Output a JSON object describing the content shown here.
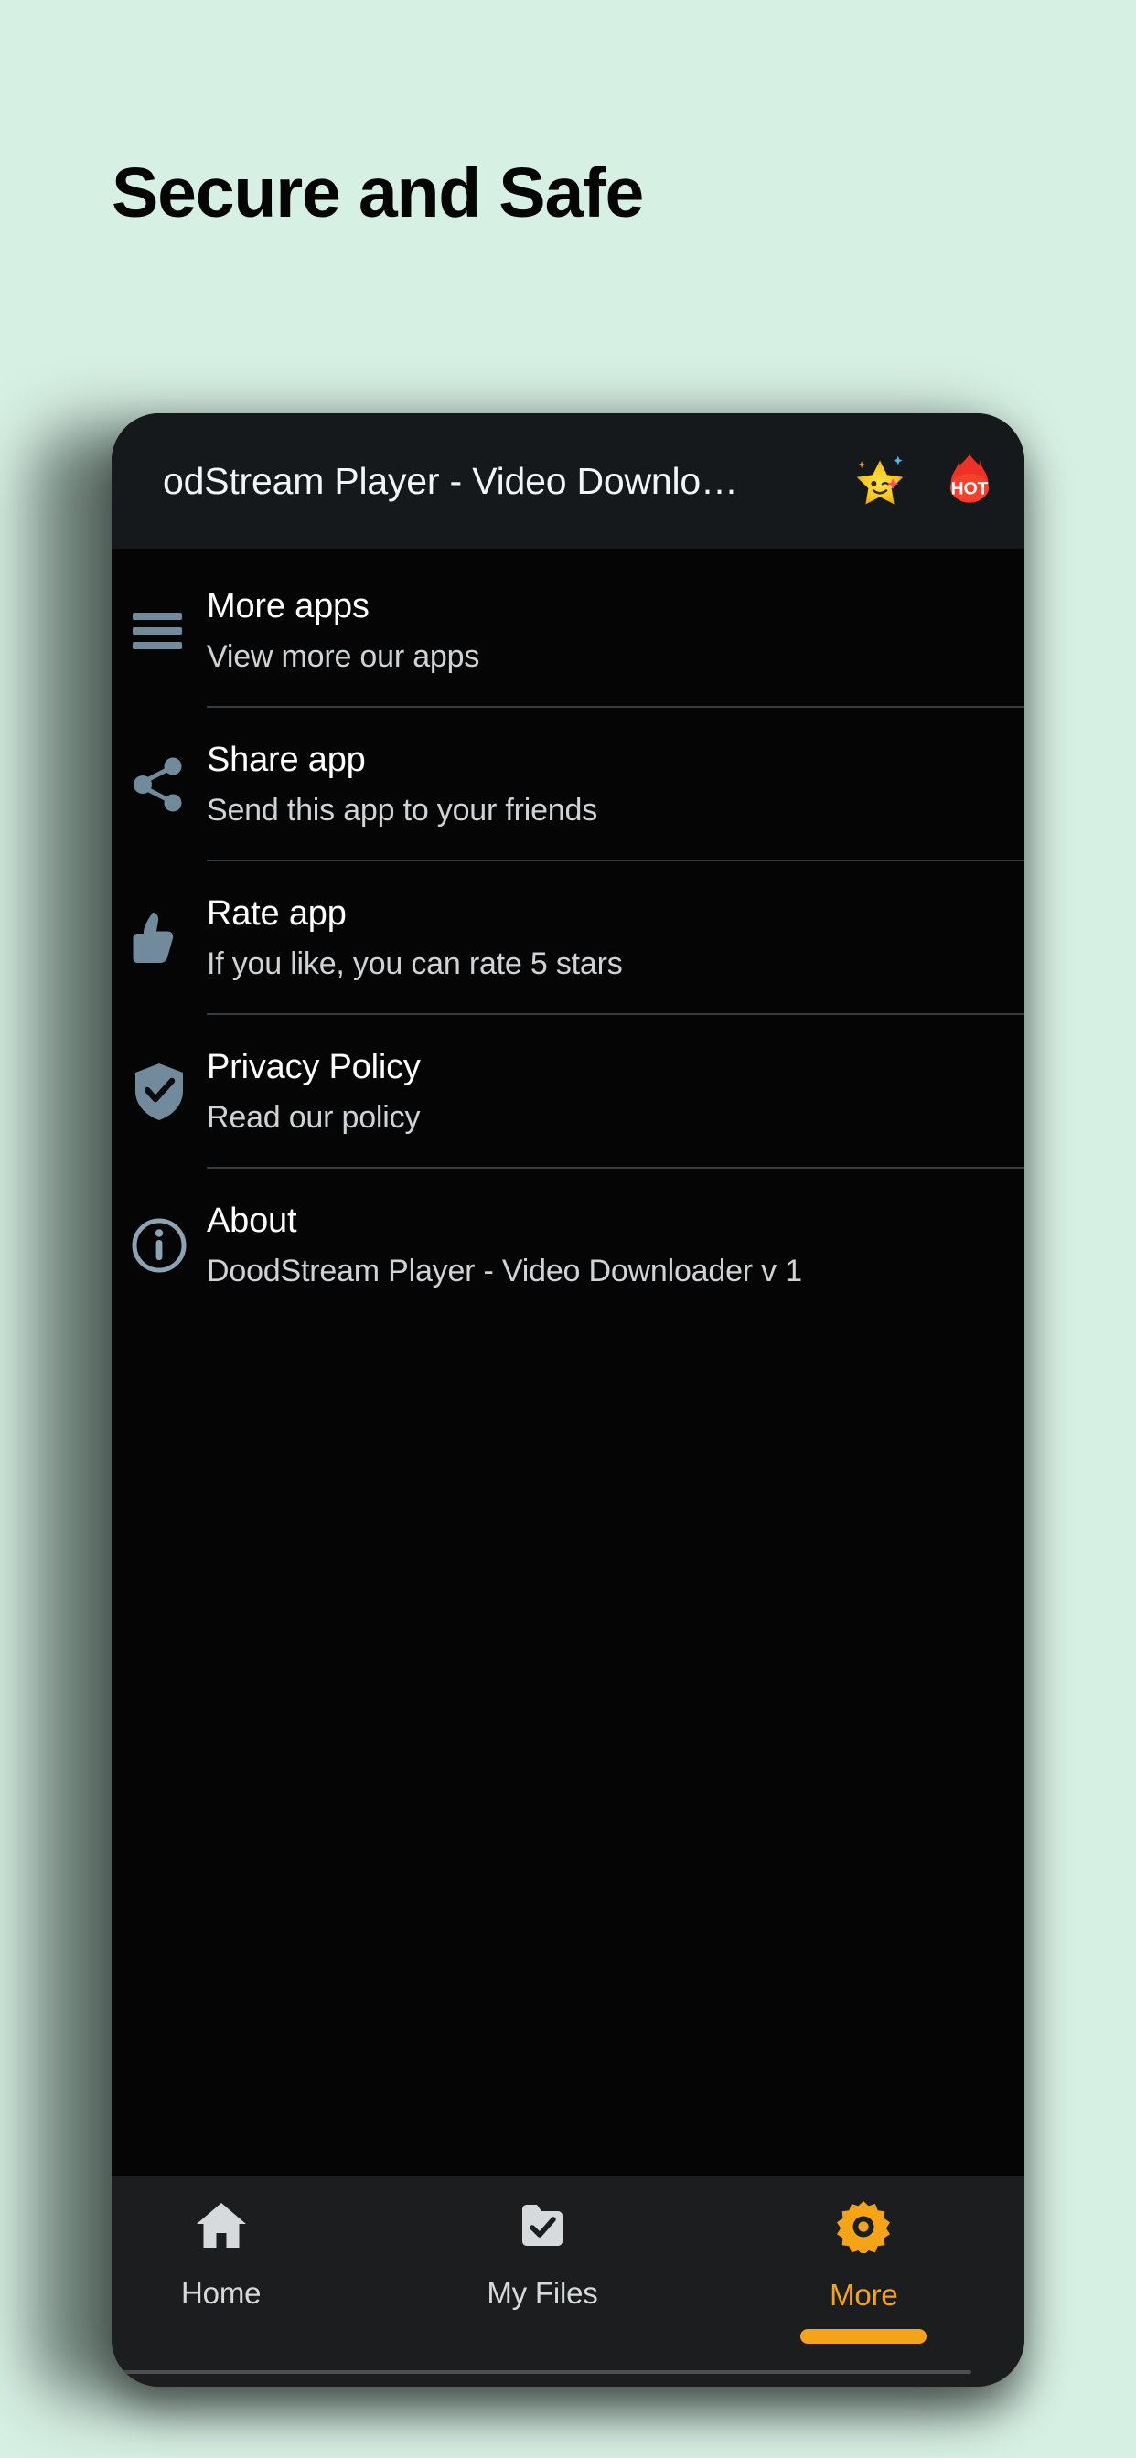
{
  "page": {
    "background_color": "#d7f0e4",
    "headline": "Secure and Safe"
  },
  "phone": {
    "appbar": {
      "title": "odStream Player - Video Downlo…",
      "background_color": "#15191b",
      "actions": [
        {
          "name": "star-emoji-icon",
          "glyph": "🌟",
          "label": "Star"
        },
        {
          "name": "hot-badge-icon",
          "label": "HOT",
          "color": "#ef3024"
        }
      ]
    },
    "menu": {
      "items": [
        {
          "icon": "hamburger-menu-icon",
          "title": "More apps",
          "subtitle": "View more our apps",
          "divider": true
        },
        {
          "icon": "share-icon",
          "title": "Share app",
          "subtitle": "Send this app to your friends",
          "divider": true
        },
        {
          "icon": "thumbs-up-icon",
          "title": "Rate app",
          "subtitle": "If you like, you can rate 5 stars",
          "divider": true
        },
        {
          "icon": "shield-check-icon",
          "title": "Privacy Policy",
          "subtitle": "Read our policy",
          "divider": true
        },
        {
          "icon": "info-circle-icon",
          "title": "About",
          "subtitle": "DoodStream Player - Video Downloader v 1",
          "divider": false
        }
      ],
      "icon_color": "#718a9c",
      "title_color": "#ffffff",
      "subtitle_color": "#cfd3d6",
      "divider_color": "#3a3d3f"
    },
    "bottom_nav": {
      "background_color": "#1b1d1f",
      "active_color": "#f5a317",
      "inactive_color": "#d6dadd",
      "items": [
        {
          "icon": "home-icon",
          "label": "Home",
          "active": false
        },
        {
          "icon": "folder-check-icon",
          "label": "My Files",
          "active": false
        },
        {
          "icon": "gear-icon",
          "label": "More",
          "active": true
        }
      ]
    }
  }
}
